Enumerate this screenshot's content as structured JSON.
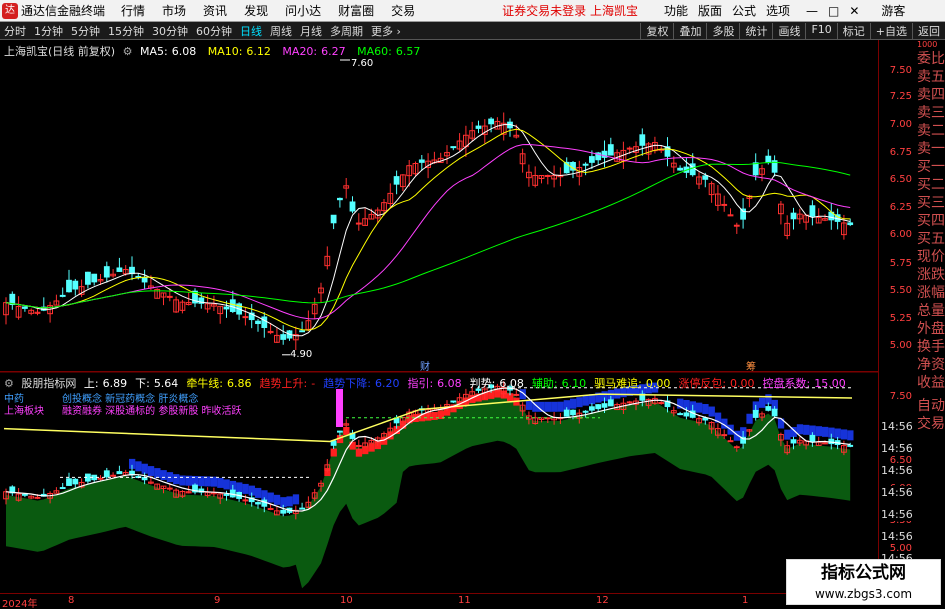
{
  "menubar": {
    "app_name": "通达信金融终端",
    "items": [
      "行情",
      "市场",
      "资讯",
      "发现",
      "问小达",
      "财富圈",
      "交易"
    ],
    "warning": "证券交易未登录 上海凯宝",
    "right_items": [
      "功能",
      "版面",
      "公式",
      "选项"
    ],
    "window_controls": [
      "—",
      "□",
      "✕"
    ],
    "guest": "游客"
  },
  "periodbar": {
    "periods": [
      "分时",
      "1分钟",
      "5分钟",
      "15分钟",
      "30分钟",
      "60分钟",
      "日线",
      "周线",
      "月线",
      "多周期",
      "更多 ›"
    ],
    "active": "日线",
    "right_buttons": [
      "复权",
      "叠加",
      "多股",
      "统计",
      "画线",
      "F10",
      "标记",
      "+自选",
      "返回"
    ]
  },
  "main_chart": {
    "stock_label": "上海凯宝(日线 前复权)",
    "ma": [
      {
        "label": "MA5:",
        "value": "6.08",
        "color": "#ffffff"
      },
      {
        "label": "MA10:",
        "value": "6.12",
        "color": "#ffff00"
      },
      {
        "label": "MA20:",
        "value": "6.27",
        "color": "#ff40ff"
      },
      {
        "label": "MA60:",
        "value": "6.57",
        "color": "#00ff00"
      }
    ],
    "high_label": "7.60",
    "low_label": "4.90",
    "marker_cai": "财",
    "marker_chou": "筹"
  },
  "sub_chart": {
    "indicator": "股朋指标网",
    "values": [
      {
        "label": "上:",
        "value": "6.89",
        "color": "#ffffff"
      },
      {
        "label": "下:",
        "value": "5.64",
        "color": "#ffffff"
      },
      {
        "label": "牵牛线:",
        "value": "6.86",
        "color": "#ffff00"
      },
      {
        "label": "趋势上升:",
        "value": "-",
        "color": "#ff2020"
      },
      {
        "label": "趋势下降:",
        "value": "6.20",
        "color": "#2040ff"
      },
      {
        "label": "指引:",
        "value": "6.08",
        "color": "#ff40ff"
      },
      {
        "label": "判势:",
        "value": "6.08",
        "color": "#ffffff"
      },
      {
        "label": "辅助:",
        "value": "6.10",
        "color": "#00ff00"
      },
      {
        "label": "驷马难追:",
        "value": "0.00",
        "color": "#ffff00"
      },
      {
        "label": "涨停反包:",
        "value": "0.00",
        "color": "#ff2020"
      },
      {
        "label": "控盘系数:",
        "value": "15.00",
        "color": "#ff40ff"
      }
    ],
    "sector_label1": "中药",
    "sector_label2": "上海板块",
    "concepts1": "创投概念 新冠药概念 肝炎概念",
    "concepts2": "融资融券 深股通标的 参股新股 昨收活跃"
  },
  "axis_main": [
    "7.50",
    "7.25",
    "7.00",
    "6.75",
    "6.50",
    "6.25",
    "6.00",
    "5.75",
    "5.50",
    "5.25",
    "5.00"
  ],
  "axis_sub": [
    "7.50",
    "7.00",
    "6.50",
    "6.00",
    "5.50",
    "5.00"
  ],
  "time_labels": [
    "14:56",
    "14:56",
    "14:56",
    "14:56",
    "14:56",
    "14:56",
    "14:56",
    "14:56"
  ],
  "date_labels": [
    "2024年",
    "8",
    "9",
    "10",
    "11",
    "12",
    "1"
  ],
  "side_panel": [
    "委比",
    "卖五",
    "卖四",
    "卖三",
    "卖二",
    "卖一",
    "买一",
    "买二",
    "买三",
    "买四",
    "买五",
    "现价",
    "涨跌",
    "涨幅",
    "总量",
    "外盘",
    "换手",
    "净资",
    "收益",
    "自动",
    "交易"
  ],
  "side_top_label": "1000",
  "watermark": {
    "title": "指标公式网",
    "url": "www.zbgs3.com"
  }
}
